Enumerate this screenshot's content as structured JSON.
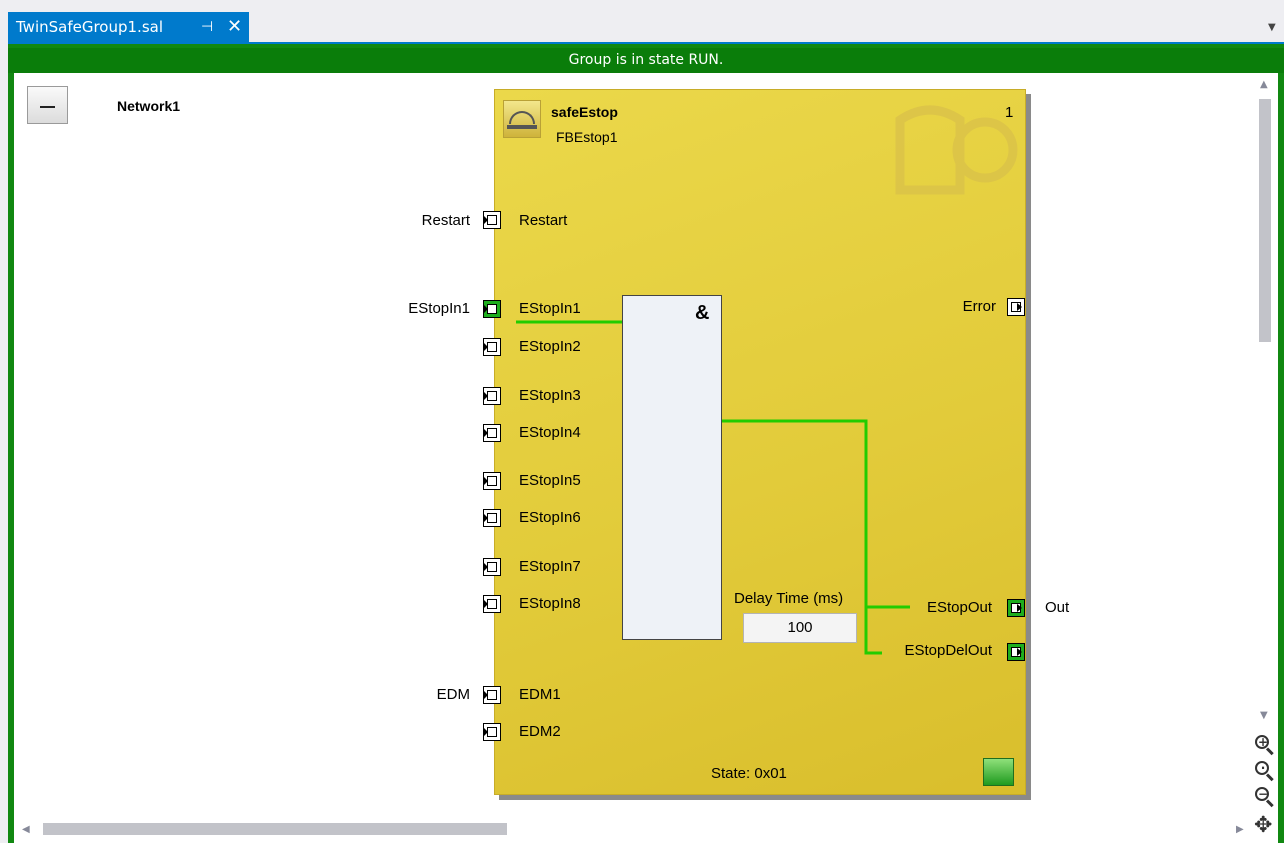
{
  "tab": {
    "title": "TwinSafeGroup1.sal",
    "pin_glyph": "⊣",
    "close_glyph": "✕"
  },
  "status_message": "Group is in state RUN.",
  "network": {
    "title": "Network1"
  },
  "fb": {
    "type": "safeEstop",
    "instance": "FBEstop1",
    "number": "1",
    "state": "State: 0x01"
  },
  "inputs": {
    "restart": {
      "port": "Restart",
      "var": "Restart"
    },
    "estop1": {
      "port": "EStopIn1",
      "var": "EStopIn1"
    },
    "estop2": {
      "port": "EStopIn2"
    },
    "estop3": {
      "port": "EStopIn3"
    },
    "estop4": {
      "port": "EStopIn4"
    },
    "estop5": {
      "port": "EStopIn5"
    },
    "estop6": {
      "port": "EStopIn6"
    },
    "estop7": {
      "port": "EStopIn7"
    },
    "estop8": {
      "port": "EStopIn8"
    },
    "edm1": {
      "port": "EDM1",
      "var": "EDM"
    },
    "edm2": {
      "port": "EDM2"
    }
  },
  "outputs": {
    "error": {
      "port": "Error"
    },
    "estopout": {
      "port": "EStopOut",
      "var": "Out"
    },
    "estopdelout": {
      "port": "EStopDelOut"
    }
  },
  "and_symbol": "&",
  "delay": {
    "label": "Delay Time (ms)",
    "value": "100"
  },
  "colors": {
    "tab_blue": "#007acc",
    "run_green": "#0a7d0a",
    "wire_green": "#22cc00",
    "fb_yellow": "#e2cb3a"
  },
  "icons": [
    "pin-icon",
    "close-icon",
    "emergency-stop-icon",
    "zoom-in-icon",
    "zoom-reset-icon",
    "zoom-out-icon",
    "pan-icon"
  ]
}
